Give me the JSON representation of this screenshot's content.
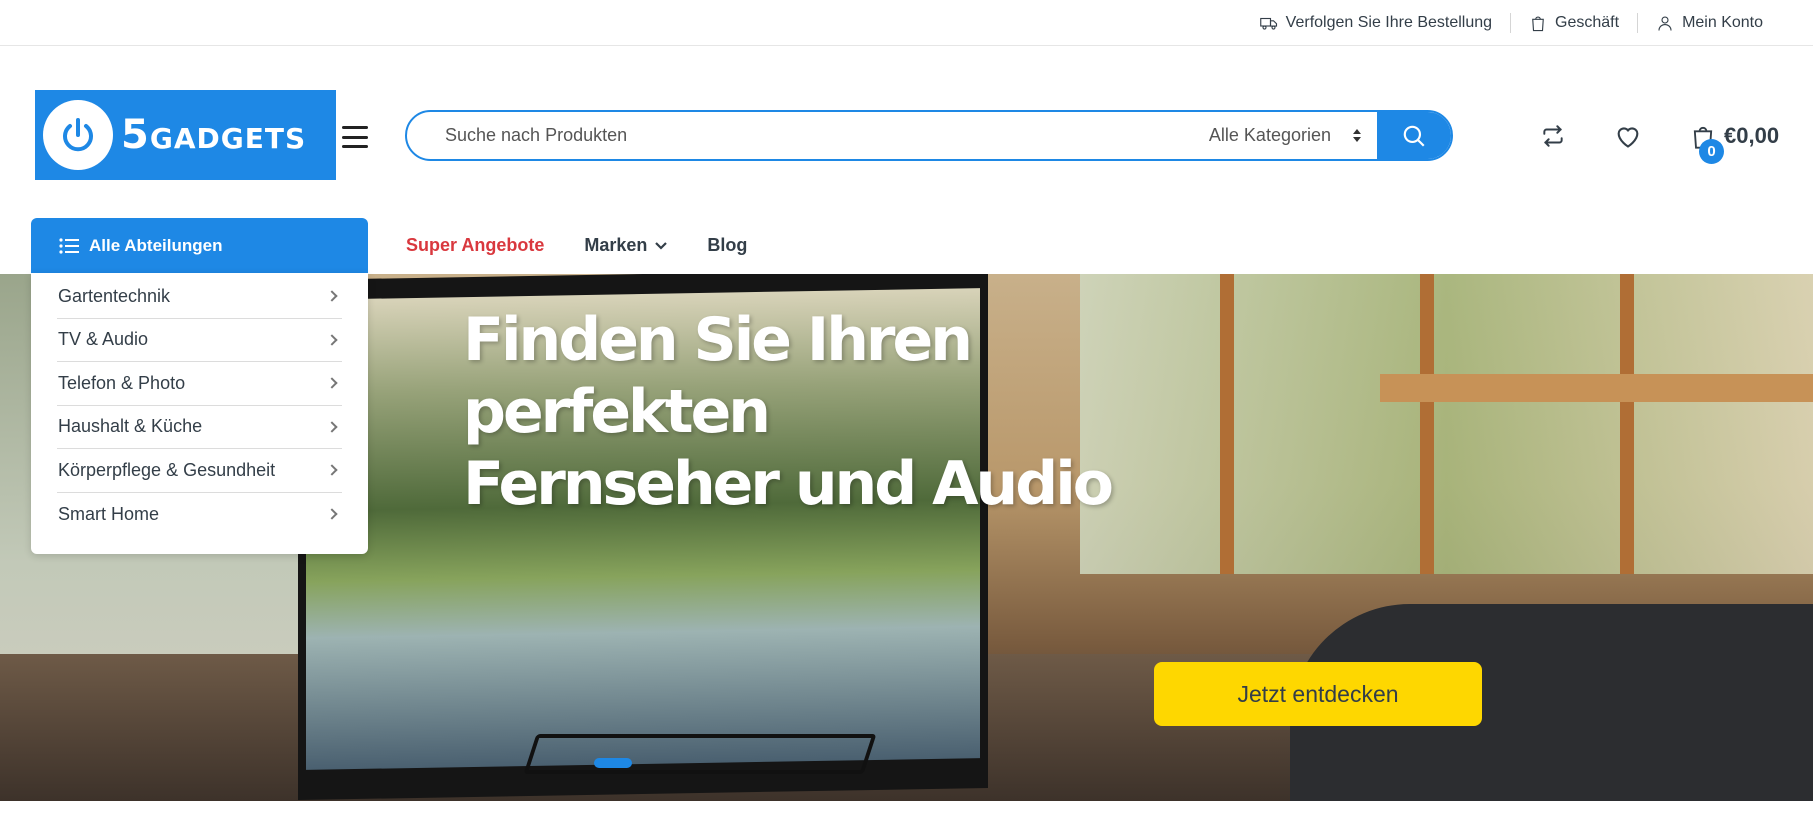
{
  "topbar": {
    "track_order": "Verfolgen Sie Ihre Bestellung",
    "shop": "Geschäft",
    "account": "Mein Konto"
  },
  "logo": {
    "text_big": "5",
    "text": "GADGETS"
  },
  "search": {
    "placeholder": "Suche nach Produkten",
    "category": "Alle Kategorien"
  },
  "cart": {
    "count": "0",
    "total": "€0,00"
  },
  "nav": {
    "departments": "Alle Abteilungen",
    "links": {
      "deals": "Super Angebote",
      "brands": "Marken",
      "blog": "Blog"
    }
  },
  "departments": [
    "Gartentechnik",
    "TV & Audio",
    "Telefon & Photo",
    "Haushalt & Küche",
    "Körperpflege & Gesundheit",
    "Smart Home"
  ],
  "hero": {
    "title_line1": "Finden Sie Ihren perfekten",
    "title_line2": "Fernseher und Audio",
    "cta": "Jetzt entdecken"
  },
  "colors": {
    "primary": "#1e88e5",
    "cta": "#fed700",
    "deal": "#d9383e"
  }
}
